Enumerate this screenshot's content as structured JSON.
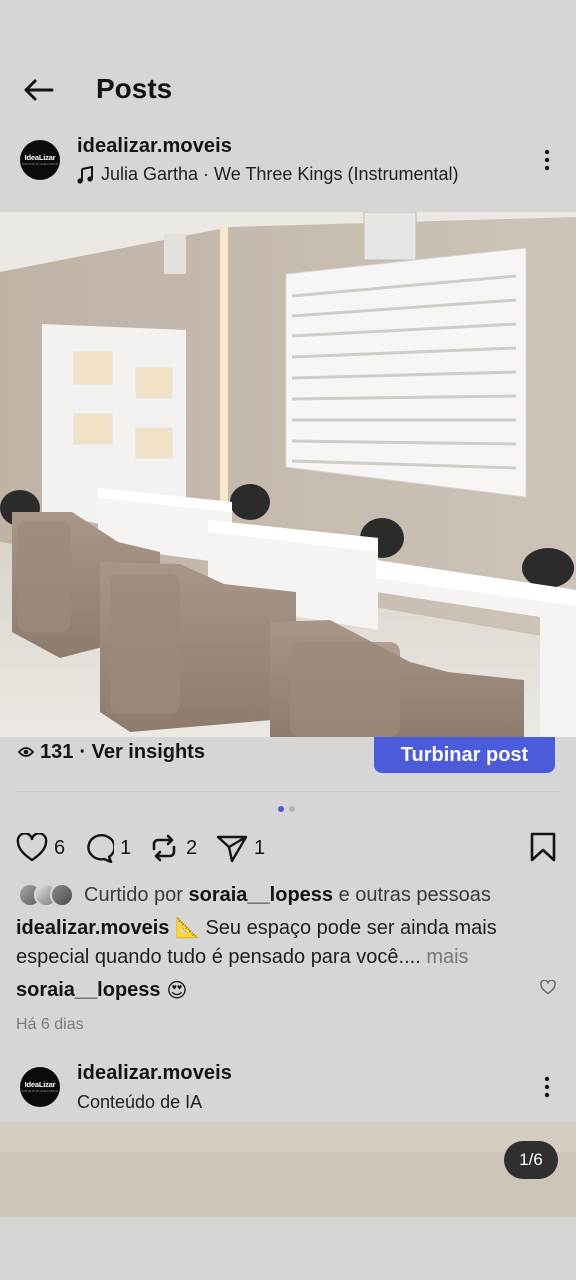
{
  "header": {
    "title": "Posts"
  },
  "post": {
    "avatar_text": "IdeaLizar",
    "avatar_subtext": "MOVEIS PLANEJADOS",
    "username": "idealizar.moveis",
    "music_icon": "music-note-icon",
    "music": "Julia Gartha · We Three Kings (Instrumental)",
    "views": "131",
    "insights_label": "· Ver insights",
    "boost_label": "Turbinar post",
    "carousel": {
      "count": 2,
      "active": 0
    },
    "likes": "6",
    "comments": "1",
    "reposts": "2",
    "shares": "1",
    "liked_by_prefix": "Curtido por",
    "liked_by_user": "soraia__lopess",
    "liked_by_suffix": "e outras pessoas",
    "caption_user": "idealizar.moveis",
    "caption_emoji": "📐",
    "caption_text": "Seu espaço pode ser ainda mais especial quando tudo é pensado para você....",
    "caption_more": "mais",
    "comment_user": "soraia__lopess",
    "comment_text": "😍",
    "date": "Há 6 dias"
  },
  "next_post": {
    "avatar_text": "IdeaLizar",
    "avatar_subtext": "MOVEIS PLANEJADOS",
    "username": "idealizar.moveis",
    "subtitle": "Conteúdo de IA",
    "counter": "1/6"
  },
  "colors": {
    "background": "#d6d6d6",
    "accent": "#4a5bdc",
    "text": "#141414"
  }
}
